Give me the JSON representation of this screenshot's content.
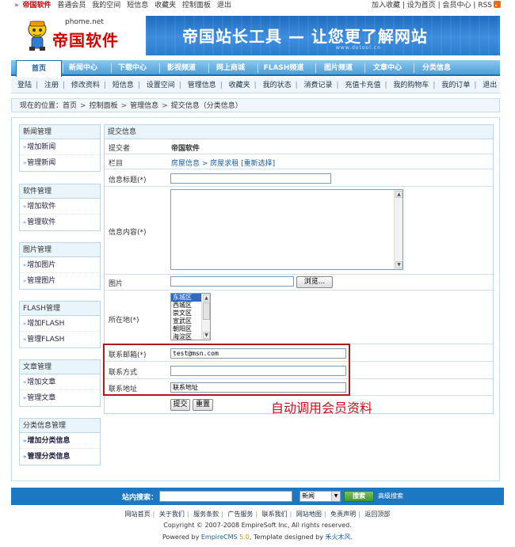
{
  "topbar": {
    "marker": "»",
    "brand": "帝国软件",
    "left_links": [
      "普通会员",
      "我的空间",
      "短信息",
      "收藏夹",
      "控制面板",
      "退出"
    ],
    "right_links": [
      "加入收藏",
      "设为首页",
      "会员中心",
      "RSS"
    ]
  },
  "header": {
    "site_url": "phome.net",
    "logo_text": "帝国软件",
    "banner_text": "帝国站长工具 — 让您更了解网站",
    "banner_sub": "www.dotool.cn"
  },
  "mainnav": [
    "首页",
    "新闻中心",
    "下载中心",
    "影视频道",
    "网上商城",
    "FLASH频道",
    "图片频道",
    "文章中心",
    "分类信息"
  ],
  "subnav": [
    "登陆",
    "注册",
    "修改资料",
    "短信息",
    "设置空间",
    "管理信息",
    "收藏夹",
    "我的状态",
    "消费记录",
    "充值卡充值",
    "我的购物车",
    "我的订单",
    "退出"
  ],
  "breadcrumb": {
    "prefix": "现在的位置：",
    "items": [
      "首页",
      "控制面板",
      "管理信息",
      "提交信息（分类信息）"
    ]
  },
  "sidebar": [
    {
      "title": "新闻管理",
      "items": [
        "增加新闻",
        "管理新闻"
      ]
    },
    {
      "title": "软件管理",
      "items": [
        "增加软件",
        "管理软件"
      ]
    },
    {
      "title": "图片管理",
      "items": [
        "增加图片",
        "管理图片"
      ]
    },
    {
      "title": "FLASH管理",
      "items": [
        "增加FLASH",
        "管理FLASH"
      ]
    },
    {
      "title": "文章管理",
      "items": [
        "增加文章",
        "管理文章"
      ]
    },
    {
      "title": "分类信息管理",
      "items": [
        "增加分类信息",
        "管理分类信息"
      ]
    }
  ],
  "form": {
    "title": "提交信息",
    "submitter_label": "提交者",
    "submitter_value": "帝国软件",
    "column_label": "栏目",
    "column_path": "房屋信息 > 房屋求租",
    "column_reselect": "[重新选择]",
    "info_title_label": "信息标题(*)",
    "info_content_label": "信息内容(*)",
    "picture_label": "图片",
    "browse_button": "浏览...",
    "location_label": "所在地(*)",
    "locations": [
      "东城区",
      "西城区",
      "崇文区",
      "宣武区",
      "朝阳区",
      "海淀区"
    ],
    "email_label": "联系邮箱(*)",
    "email_value": "test@msn.com",
    "contact_label": "联系方式",
    "contact_value": "",
    "address_label": "联系地址",
    "address_value": "联系地址",
    "submit_button": "提交",
    "reset_button": "重置"
  },
  "annotation": "自动调用会员资料",
  "footer": {
    "search_label": "站内搜索：",
    "search_select": "新闻",
    "search_button": "搜索",
    "advanced_search": "高级搜索",
    "links": [
      "网站首页",
      "关于我们",
      "服务条款",
      "广告服务",
      "联系我们",
      "网站地图",
      "免责声明",
      "返回顶部"
    ],
    "copyright": "Copyright © 2007-2008 EmpireSoft Inc, All rights reserved.",
    "powered_prefix": "Powered by",
    "powered_cms": "EmpireCMS",
    "powered_version": "5.0",
    "powered_mid": ", Template designed by",
    "powered_author": "禾火木风",
    "powered_end": "."
  }
}
